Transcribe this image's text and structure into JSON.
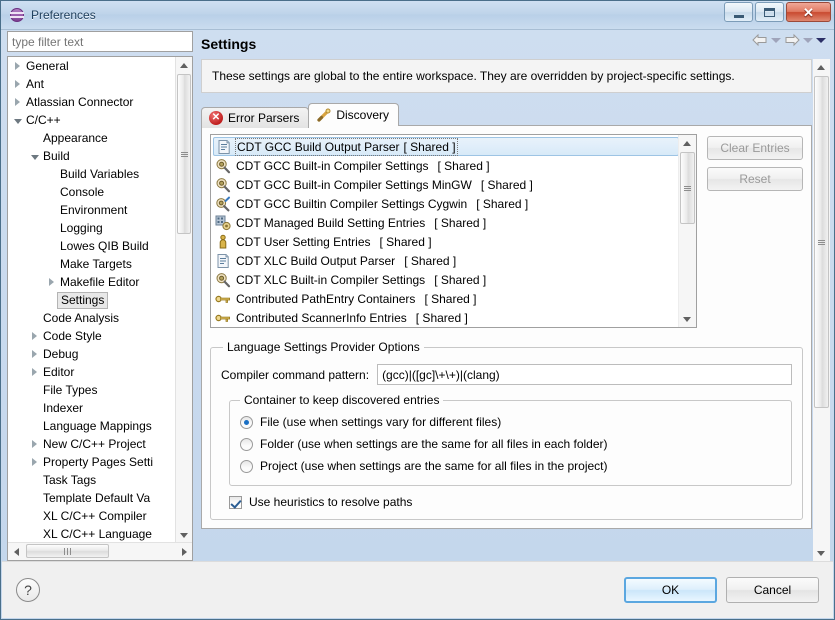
{
  "window": {
    "title": "Preferences",
    "app_icon": "globe-icon",
    "minimize_label": "Minimize",
    "maximize_label": "Restore",
    "close_label": "Close"
  },
  "sidebar": {
    "filter_placeholder": "type filter text",
    "filter_value": "",
    "items": [
      {
        "label": "General",
        "indent": 0,
        "twisty": "collapsed",
        "selected": false
      },
      {
        "label": "Ant",
        "indent": 0,
        "twisty": "collapsed",
        "selected": false
      },
      {
        "label": "Atlassian Connector",
        "indent": 0,
        "twisty": "collapsed",
        "selected": false
      },
      {
        "label": "C/C++",
        "indent": 0,
        "twisty": "expanded",
        "selected": false
      },
      {
        "label": "Appearance",
        "indent": 1,
        "twisty": "none",
        "selected": false
      },
      {
        "label": "Build",
        "indent": 1,
        "twisty": "expanded",
        "selected": false
      },
      {
        "label": "Build Variables",
        "indent": 2,
        "twisty": "none",
        "selected": false
      },
      {
        "label": "Console",
        "indent": 2,
        "twisty": "none",
        "selected": false
      },
      {
        "label": "Environment",
        "indent": 2,
        "twisty": "none",
        "selected": false
      },
      {
        "label": "Logging",
        "indent": 2,
        "twisty": "none",
        "selected": false
      },
      {
        "label": "Lowes QIB Build",
        "indent": 2,
        "twisty": "none",
        "selected": false
      },
      {
        "label": "Make Targets",
        "indent": 2,
        "twisty": "none",
        "selected": false
      },
      {
        "label": "Makefile Editor",
        "indent": 2,
        "twisty": "collapsed",
        "selected": false
      },
      {
        "label": "Settings",
        "indent": 2,
        "twisty": "none",
        "selected": true
      },
      {
        "label": "Code Analysis",
        "indent": 1,
        "twisty": "none",
        "selected": false
      },
      {
        "label": "Code Style",
        "indent": 1,
        "twisty": "collapsed",
        "selected": false
      },
      {
        "label": "Debug",
        "indent": 1,
        "twisty": "collapsed",
        "selected": false
      },
      {
        "label": "Editor",
        "indent": 1,
        "twisty": "collapsed",
        "selected": false
      },
      {
        "label": "File Types",
        "indent": 1,
        "twisty": "none",
        "selected": false
      },
      {
        "label": "Indexer",
        "indent": 1,
        "twisty": "none",
        "selected": false
      },
      {
        "label": "Language Mappings",
        "indent": 1,
        "twisty": "none",
        "selected": false
      },
      {
        "label": "New C/C++ Project",
        "indent": 1,
        "twisty": "collapsed",
        "selected": false
      },
      {
        "label": "Property Pages Setti",
        "indent": 1,
        "twisty": "collapsed",
        "selected": false
      },
      {
        "label": "Task Tags",
        "indent": 1,
        "twisty": "none",
        "selected": false
      },
      {
        "label": "Template Default Va",
        "indent": 1,
        "twisty": "none",
        "selected": false
      },
      {
        "label": "XL C/C++ Compiler",
        "indent": 1,
        "twisty": "none",
        "selected": false
      },
      {
        "label": "XL C/C++ Language",
        "indent": 1,
        "twisty": "none",
        "selected": false
      }
    ]
  },
  "page": {
    "title": "Settings",
    "description": "These settings are global to the entire workspace.  They are overridden by project-specific settings.",
    "nav": {
      "back": "back-arrow",
      "back_menu": "back-dropdown",
      "forward": "forward-arrow",
      "forward_menu": "forward-dropdown",
      "view_menu": "view-menu"
    }
  },
  "tabs": [
    {
      "label": "Error Parsers",
      "icon": "error-icon",
      "active": false
    },
    {
      "label": "Discovery",
      "icon": "wand-icon",
      "active": true
    }
  ],
  "providers": {
    "items": [
      {
        "name": "CDT GCC Build Output Parser",
        "scope": "[ Shared ]",
        "icon": "parser-document-icon",
        "selected": true
      },
      {
        "name": "CDT GCC Built-in Compiler Settings",
        "scope": "[ Shared ]",
        "icon": "magnifier-gear-icon",
        "selected": false
      },
      {
        "name": "CDT GCC Built-in Compiler Settings MinGW",
        "scope": "[ Shared ]",
        "icon": "magnifier-gear-icon",
        "selected": false
      },
      {
        "name": "CDT GCC Builtin Compiler Settings Cygwin",
        "scope": "[ Shared ]",
        "icon": "magnifier-key-icon",
        "selected": false
      },
      {
        "name": "CDT Managed Build Setting Entries",
        "scope": "[ Shared ]",
        "icon": "build-settings-icon",
        "selected": false
      },
      {
        "name": "CDT User Setting Entries",
        "scope": "[ Shared ]",
        "icon": "person-icon",
        "selected": false
      },
      {
        "name": "CDT XLC Build Output Parser",
        "scope": "[ Shared ]",
        "icon": "parser-document-icon",
        "selected": false
      },
      {
        "name": "CDT XLC Built-in Compiler Settings",
        "scope": "[ Shared ]",
        "icon": "magnifier-gear-icon",
        "selected": false
      },
      {
        "name": "Contributed PathEntry Containers",
        "scope": "[ Shared ]",
        "icon": "key-icon",
        "selected": false
      },
      {
        "name": "Contributed ScannerInfo Entries",
        "scope": "[ Shared ]",
        "icon": "key-icon",
        "selected": false
      }
    ],
    "buttons": {
      "clear_entries": "Clear Entries",
      "reset": "Reset"
    }
  },
  "options": {
    "group_title": "Language Settings Provider Options",
    "compiler_pattern_label": "Compiler command pattern:",
    "compiler_pattern_value": "(gcc)|([gc]\\+\\+)|(clang)",
    "container_group_title": "Container to keep discovered entries",
    "radios": [
      {
        "label": "File (use when settings vary for different files)",
        "checked": true
      },
      {
        "label": "Folder (use when settings are the same for all files in each folder)",
        "checked": false
      },
      {
        "label": "Project (use when settings are the same for all files in the project)",
        "checked": false
      }
    ],
    "heuristics_label": "Use heuristics to resolve paths",
    "heuristics_checked": true
  },
  "footer": {
    "help_icon": "?",
    "ok": "OK",
    "cancel": "Cancel"
  },
  "colors": {
    "accent": "#5ba7e0",
    "selection": "#d8eaf8",
    "titlebar": "#bfd4ea",
    "error": "#c02020"
  }
}
